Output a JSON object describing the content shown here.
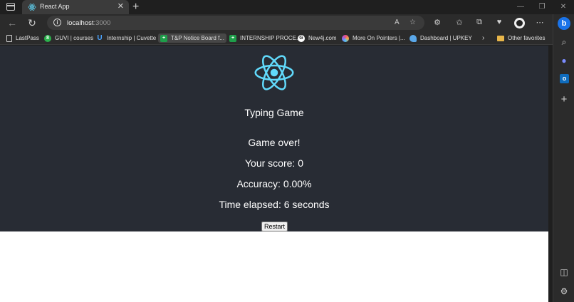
{
  "tab": {
    "title": "React App",
    "close": "✕"
  },
  "window": {
    "minimize": "—",
    "maximize": "❐",
    "close": "✕"
  },
  "address": {
    "host": "localhost",
    "port": ":3000"
  },
  "bookmarks": [
    {
      "label": "LastPass",
      "icon": "page-icon"
    },
    {
      "label": "GUVI | courses",
      "icon": "guvi-icon",
      "badge": "8"
    },
    {
      "label": "Internship | Cuvette",
      "icon": "cuvette-icon"
    },
    {
      "label": "T&P Notice Board f...",
      "icon": "notice-board-icon"
    },
    {
      "label": "INTERNSHIP PROCE...",
      "icon": "sheets-icon"
    },
    {
      "label": "New4j.com",
      "icon": "new4j-icon",
      "badge": "G"
    },
    {
      "label": "More On Pointers |...",
      "icon": "pointers-icon"
    },
    {
      "label": "Dashboard | UPKEY",
      "icon": "upkey-icon"
    },
    {
      "label": "Other favorites",
      "icon": "folder-icon"
    }
  ],
  "game": {
    "title": "Typing Game",
    "status": "Game over!",
    "score": "Your score: 0",
    "accuracy": "Accuracy: 0.00%",
    "time": "Time elapsed: 6 seconds",
    "restart_label": "Restart"
  },
  "colors": {
    "app_bg": "#282c34",
    "react_blue": "#61dafb"
  }
}
